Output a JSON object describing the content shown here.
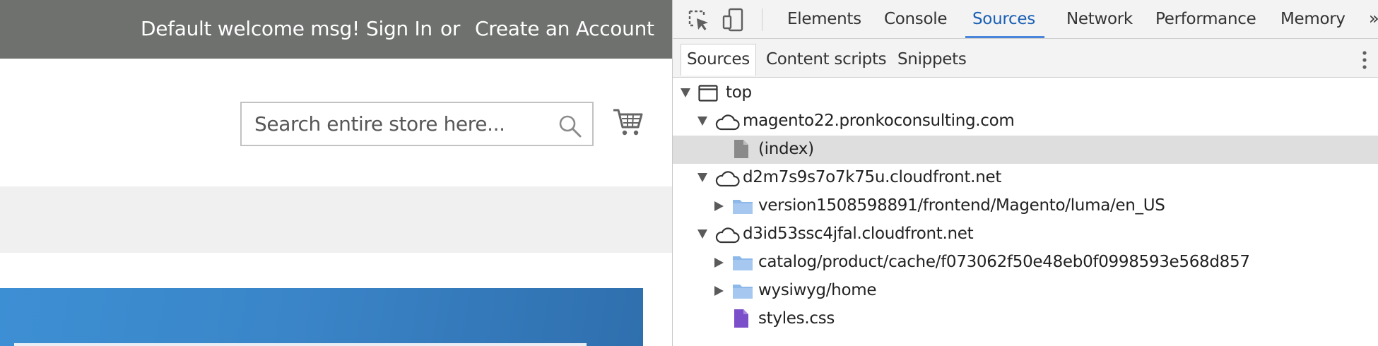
{
  "store": {
    "header": {
      "welcome": "Default welcome msg!",
      "sign_in": "Sign In",
      "or": "or",
      "create_account": "Create an Account"
    },
    "search": {
      "placeholder": "Search entire store here..."
    }
  },
  "devtools": {
    "tabs": [
      "Elements",
      "Console",
      "Sources",
      "Network",
      "Performance",
      "Memory"
    ],
    "active_tab": "Sources",
    "more_tabs_label": "»",
    "sub_tabs": [
      "Sources",
      "Content scripts",
      "Snippets"
    ],
    "tree": {
      "top": "top",
      "origins": [
        {
          "name": "magento22.pronkoconsulting.com",
          "children": [
            "(index)"
          ]
        },
        {
          "name": "d2m7s9s7o7k75u.cloudfront.net",
          "children": [
            "version1508598891/frontend/Magento/luma/en_US"
          ]
        },
        {
          "name": "d3id53ssc4jfal.cloudfront.net",
          "children": [
            "catalog/product/cache/f073062f50e48eb0f0998593e568d857",
            "wysiwyg/home",
            "styles.css"
          ]
        }
      ]
    }
  },
  "colors": {
    "header_bg": "#6e716e",
    "active_tab": "#1a5fb4",
    "folder": "#8db8ea",
    "css_file": "#7b4fc9"
  }
}
